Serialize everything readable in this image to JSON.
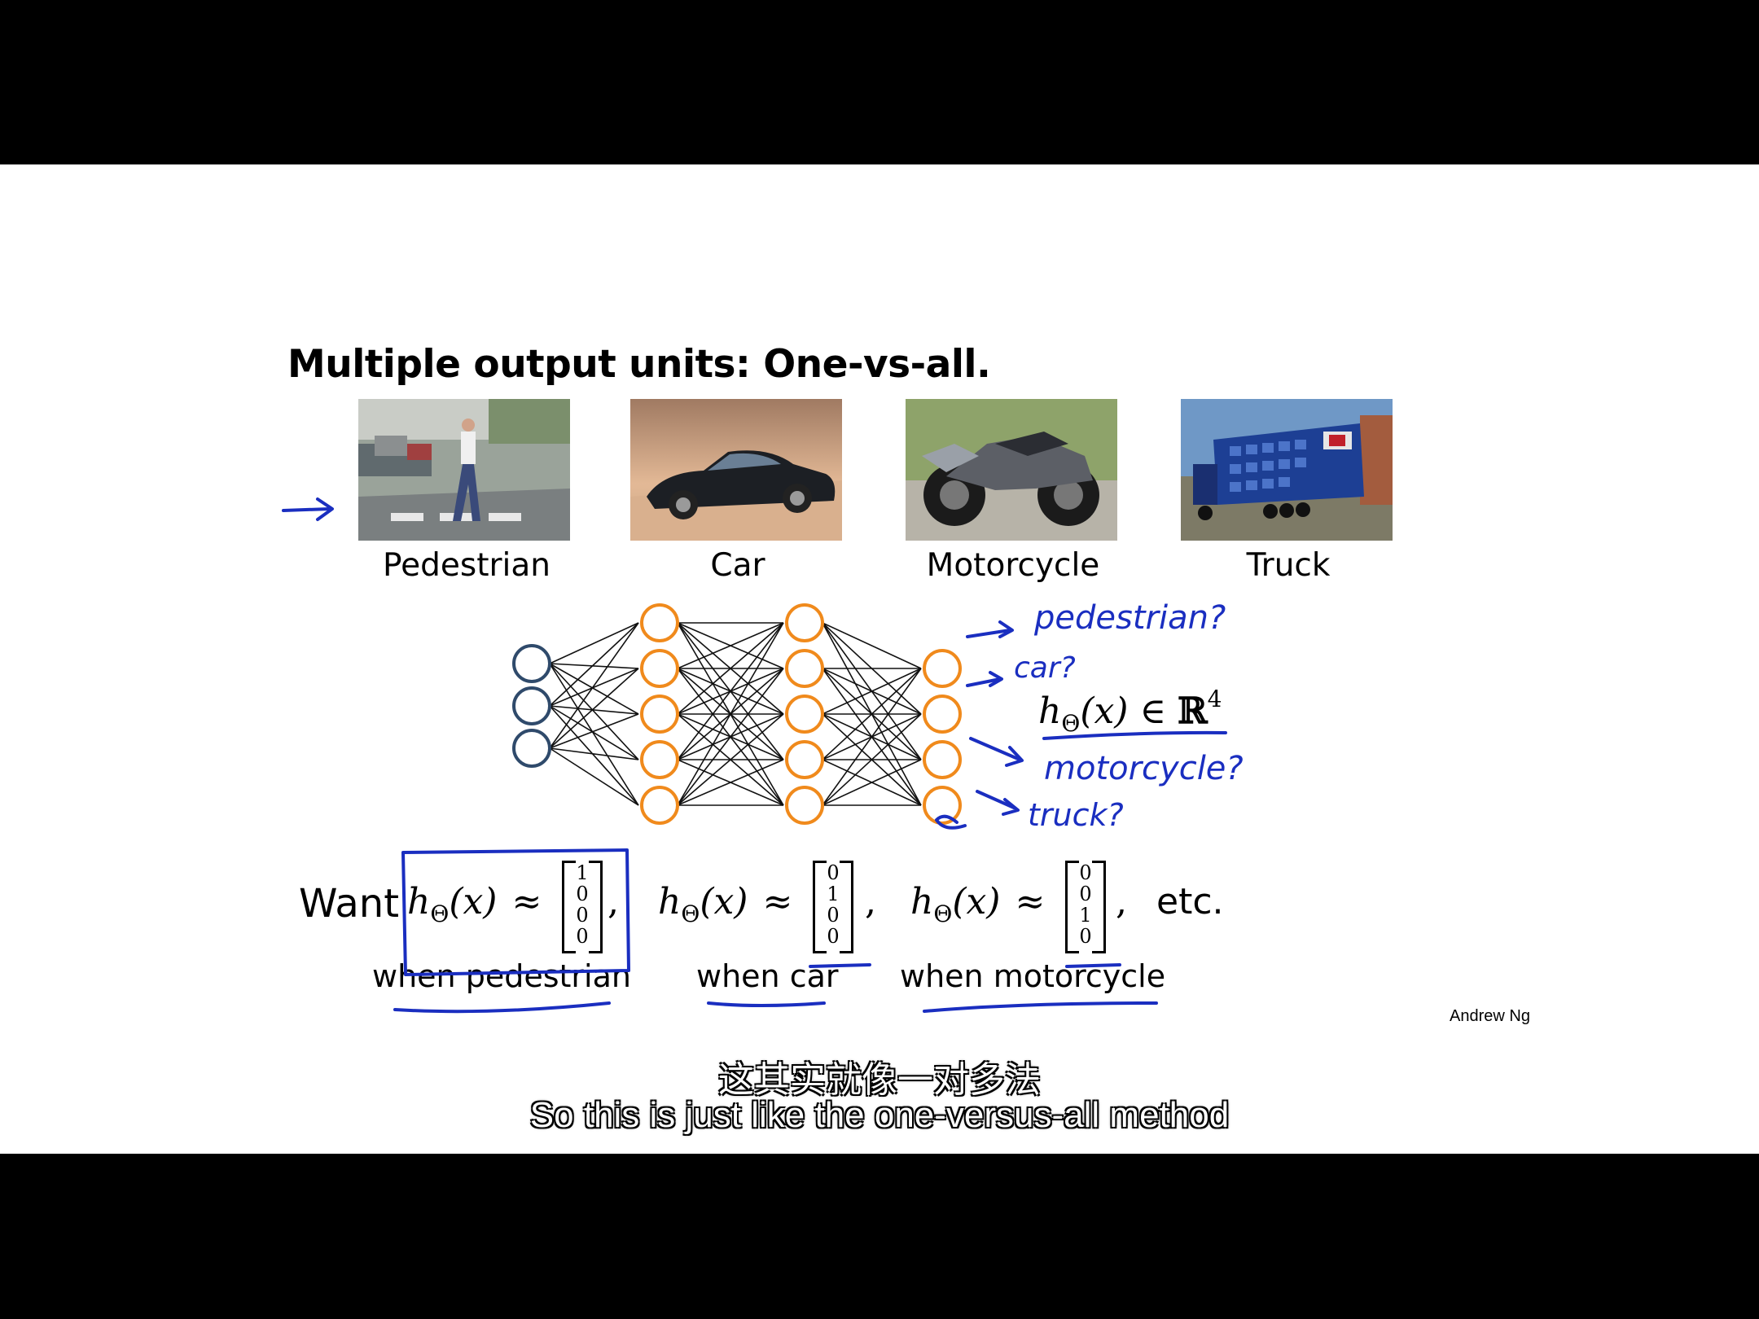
{
  "slide": {
    "title": "Multiple output units: One-vs-all.",
    "images": [
      {
        "caption": "Pedestrian",
        "icon": "pedestrian-photo"
      },
      {
        "caption": "Car",
        "icon": "car-photo"
      },
      {
        "caption": "Motorcycle",
        "icon": "motorcycle-photo"
      },
      {
        "caption": "Truck",
        "icon": "truck-photo"
      }
    ],
    "network": {
      "layers": [
        3,
        5,
        5,
        4
      ],
      "input_color": "#2f4a6b",
      "hidden_color": "#f08a1c"
    },
    "handwriting": {
      "outputs": [
        "pedestrian?",
        "car?",
        "motorcycle?",
        "truck?"
      ],
      "ink_color": "#1a2ec0"
    },
    "output_math": {
      "h": "h",
      "sub": "Θ",
      "arg": "(x) ∈ ",
      "set": "ℝ",
      "sup": "4"
    },
    "want": {
      "label": "Want",
      "h": "h",
      "sub": "Θ",
      "arg": "(x)",
      "approx": "≈",
      "vectors": [
        [
          "1",
          "0",
          "0",
          "0"
        ],
        [
          "0",
          "1",
          "0",
          "0"
        ],
        [
          "0",
          "0",
          "1",
          "0"
        ]
      ],
      "comma": ",",
      "etc": "etc.",
      "when": [
        "when pedestrian",
        "when car",
        "when motorcycle"
      ]
    },
    "author": "Andrew Ng"
  },
  "subtitles": {
    "zh": "这其实就像一对多法",
    "en": "So this is just like the one-versus-all method"
  }
}
